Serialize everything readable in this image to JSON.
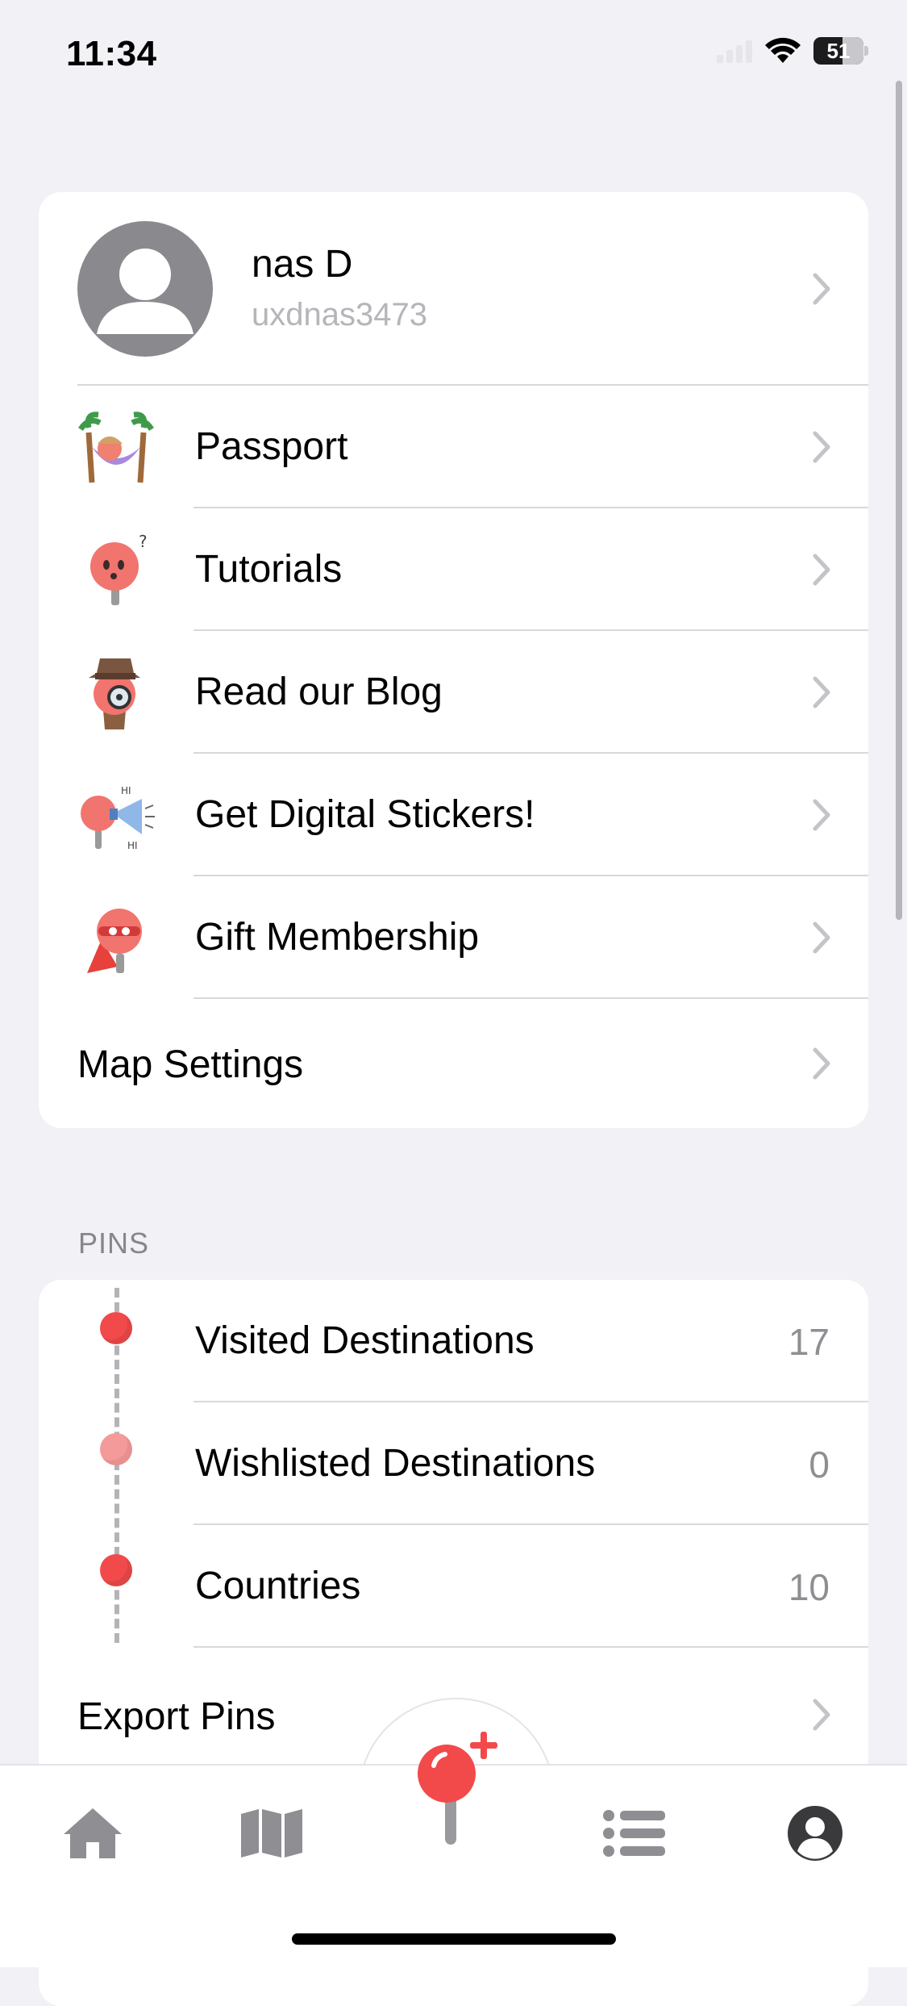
{
  "status_bar": {
    "time": "11:34",
    "battery": "51"
  },
  "profile": {
    "name": "nas D",
    "username": "uxdnas3473"
  },
  "menu": [
    {
      "label": "Passport",
      "icon": "hammock-sticker-icon"
    },
    {
      "label": "Tutorials",
      "icon": "confused-pin-sticker-icon"
    },
    {
      "label": "Read our Blog",
      "icon": "detective-pin-sticker-icon"
    },
    {
      "label": "Get Digital Stickers!",
      "icon": "megaphone-pin-sticker-icon"
    },
    {
      "label": "Gift Membership",
      "icon": "superhero-pin-sticker-icon"
    }
  ],
  "map_settings": {
    "label": "Map Settings"
  },
  "pins_section": {
    "header": "PINS",
    "items": [
      {
        "label": "Visited Destinations",
        "count": "17",
        "color": "#f24a4a"
      },
      {
        "label": "Wishlisted Destinations",
        "count": "0",
        "color": "#f59a9a"
      },
      {
        "label": "Countries",
        "count": "10",
        "color": "#f24a4a"
      }
    ],
    "export": {
      "label": "Export Pins"
    }
  },
  "tab_bar": {
    "tabs": [
      "home-icon",
      "map-icon",
      "add-pin-icon",
      "list-icon",
      "profile-icon"
    ],
    "active": "profile-icon"
  },
  "colors": {
    "accent": "#f24a4a",
    "background": "#f1f1f6",
    "secondary_text": "#8e8e93"
  }
}
